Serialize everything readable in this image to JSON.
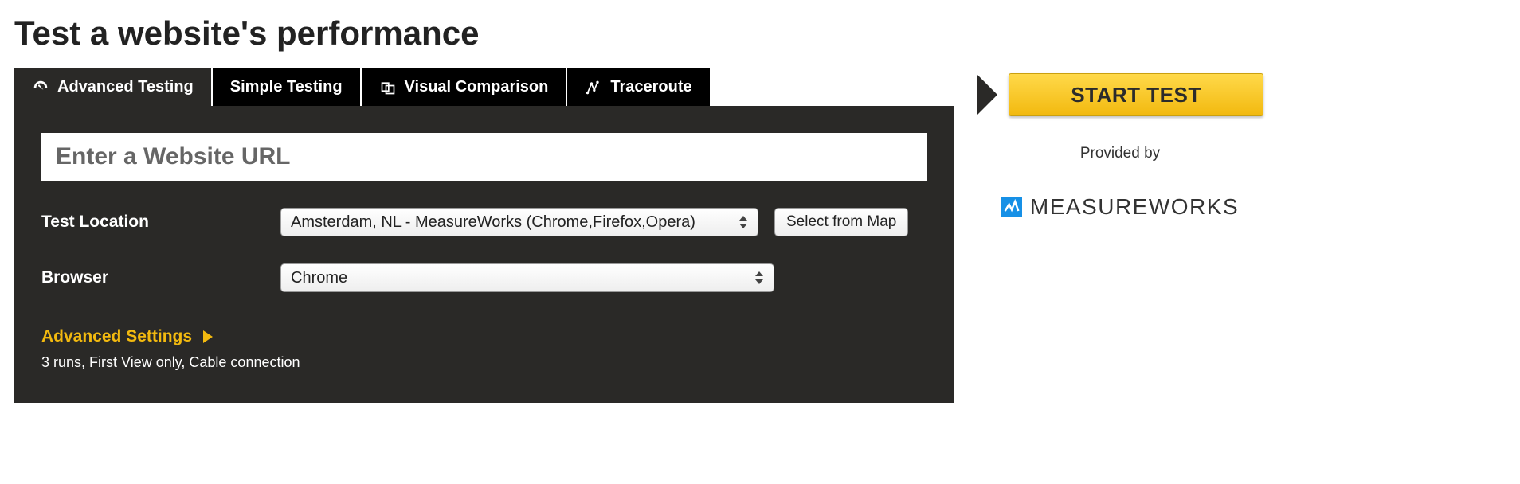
{
  "title": "Test a website's performance",
  "tabs": [
    {
      "label": "Advanced Testing",
      "icon": "gauge-icon",
      "active": true
    },
    {
      "label": "Simple Testing",
      "icon": null,
      "active": false
    },
    {
      "label": "Visual Comparison",
      "icon": "compare-icon",
      "active": false
    },
    {
      "label": "Traceroute",
      "icon": "traceroute-icon",
      "active": false
    }
  ],
  "url_input": {
    "placeholder": "Enter a Website URL",
    "value": ""
  },
  "location": {
    "label": "Test Location",
    "selected": "Amsterdam, NL - MeasureWorks (Chrome,Firefox,Opera)",
    "map_button": "Select from Map"
  },
  "browser": {
    "label": "Browser",
    "selected": "Chrome"
  },
  "advanced": {
    "link": "Advanced Settings",
    "summary": "3 runs, First View only, Cable connection"
  },
  "start_button": "START TEST",
  "provided_by": "Provided by",
  "provider_name": "MEASUREWORKS"
}
